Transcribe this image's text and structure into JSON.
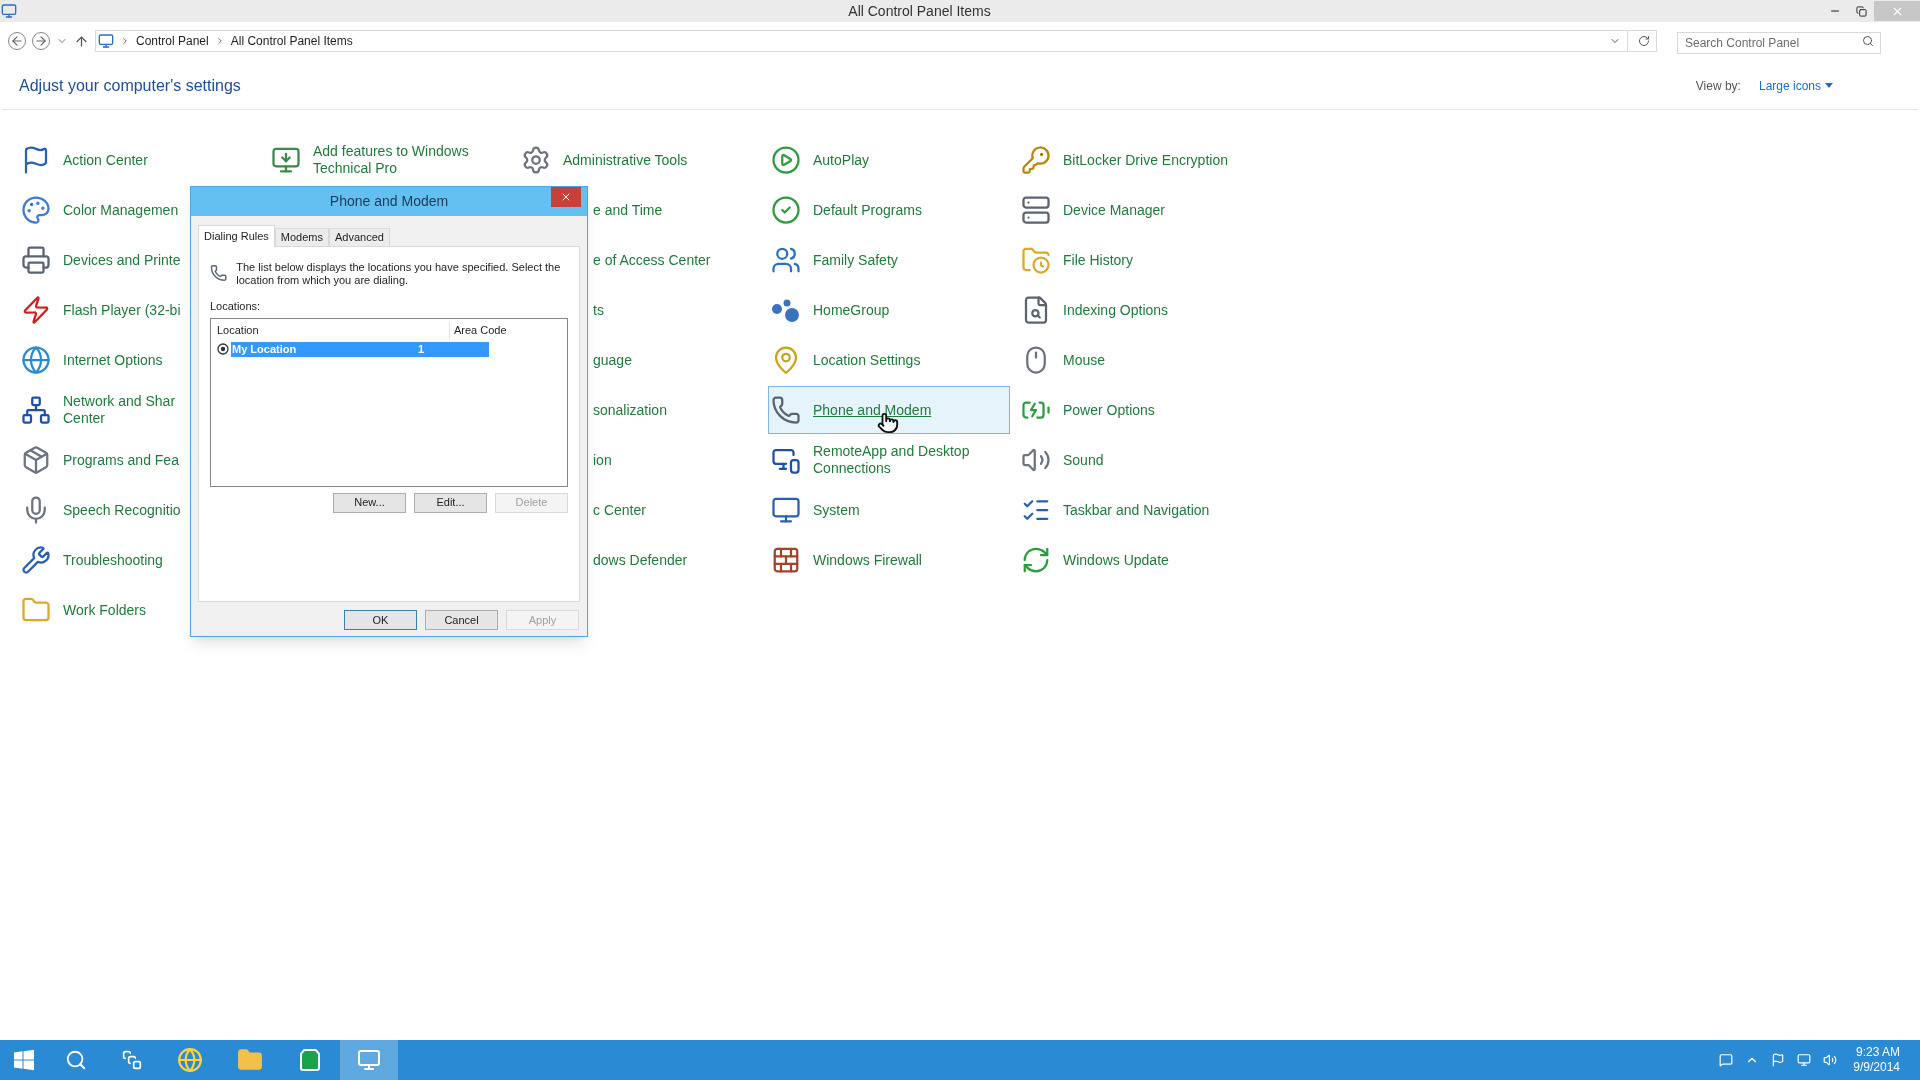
{
  "window": {
    "title": "All Control Panel Items"
  },
  "address_bar": {
    "path": [
      "Control Panel",
      "All Control Panel Items"
    ]
  },
  "search": {
    "placeholder": "Search Control Panel"
  },
  "heading": "Adjust your computer's settings",
  "view_by": {
    "label": "View by:",
    "value": "Large icons"
  },
  "columns": [
    [
      {
        "kind": "full",
        "label": "Action Center",
        "selected": false
      },
      {
        "kind": "full",
        "label": "Color Managemen",
        "selected": false
      },
      {
        "kind": "full",
        "label": "Devices and Printe",
        "selected": false
      },
      {
        "kind": "full",
        "label": "Flash Player (32-bi",
        "selected": false
      },
      {
        "kind": "full",
        "label": "Internet Options",
        "selected": false
      },
      {
        "kind": "full",
        "label": "Network and Shar\nCenter",
        "selected": false
      },
      {
        "kind": "full",
        "label": "Programs and Fea",
        "selected": false
      },
      {
        "kind": "full",
        "label": "Speech Recognitio",
        "selected": false
      },
      {
        "kind": "full",
        "label": "Troubleshooting",
        "selected": false
      },
      {
        "kind": "full",
        "label": "Work Folders",
        "selected": false
      }
    ],
    [
      {
        "kind": "full",
        "label": "Add features to Windows\nTechnical Pro",
        "selected": false
      }
    ],
    [
      {
        "kind": "full",
        "label": "Administrative Tools",
        "selected": false
      },
      {
        "kind": "cut",
        "label": "e and Time",
        "selected": false
      },
      {
        "kind": "cut",
        "label": "e of Access Center",
        "selected": false
      },
      {
        "kind": "cut",
        "label": "ts",
        "selected": false
      },
      {
        "kind": "cut",
        "label": "guage",
        "selected": false
      },
      {
        "kind": "cut",
        "label": "sonalization",
        "selected": false
      },
      {
        "kind": "cut",
        "label": "ion",
        "selected": false
      },
      {
        "kind": "cut",
        "label": "c Center",
        "selected": false
      },
      {
        "kind": "cut",
        "label": "dows Defender",
        "selected": false
      }
    ],
    [
      {
        "kind": "full",
        "label": "AutoPlay",
        "selected": false
      },
      {
        "kind": "full",
        "label": "Default Programs",
        "selected": false
      },
      {
        "kind": "full",
        "label": "Family Safety",
        "selected": false
      },
      {
        "kind": "full",
        "label": "HomeGroup",
        "selected": false
      },
      {
        "kind": "full",
        "label": "Location Settings",
        "selected": false
      },
      {
        "kind": "full",
        "label": "Phone and Modem",
        "selected": true
      },
      {
        "kind": "full",
        "label": "RemoteApp and Desktop Connections",
        "selected": false
      },
      {
        "kind": "full",
        "label": "System",
        "selected": false
      },
      {
        "kind": "full",
        "label": "Windows Firewall",
        "selected": false
      }
    ],
    [
      {
        "kind": "full",
        "label": "BitLocker Drive Encryption",
        "selected": false
      },
      {
        "kind": "full",
        "label": "Device Manager",
        "selected": false
      },
      {
        "kind": "full",
        "label": "File History",
        "selected": false
      },
      {
        "kind": "full",
        "label": "Indexing Options",
        "selected": false
      },
      {
        "kind": "full",
        "label": "Mouse",
        "selected": false
      },
      {
        "kind": "full",
        "label": "Power Options",
        "selected": false
      },
      {
        "kind": "full",
        "label": "Sound",
        "selected": false
      },
      {
        "kind": "full",
        "label": "Taskbar and Navigation",
        "selected": false
      },
      {
        "kind": "full",
        "label": "Windows Update",
        "selected": false
      }
    ]
  ],
  "dialog": {
    "title": "Phone and Modem",
    "tabs": [
      {
        "label": "Dialing Rules",
        "selected": true
      },
      {
        "label": "Modems",
        "selected": false
      },
      {
        "label": "Advanced",
        "selected": false
      }
    ],
    "description": "The list below displays the locations you have specified. Select the location from which you are dialing.",
    "list_label": "Locations:",
    "columns": [
      "Location",
      "Area Code"
    ],
    "rows": [
      {
        "location": "My Location",
        "area_code": "1",
        "selected": true
      }
    ],
    "list_buttons": [
      {
        "label": "New...",
        "disabled": false
      },
      {
        "label": "Edit...",
        "disabled": false
      },
      {
        "label": "Delete",
        "disabled": true
      }
    ],
    "buttons": [
      {
        "label": "OK",
        "disabled": false,
        "default": true
      },
      {
        "label": "Cancel",
        "disabled": false,
        "default": false
      },
      {
        "label": "Apply",
        "disabled": true,
        "default": false
      }
    ]
  },
  "taskbar": {
    "time": "9:23 AM",
    "date": "9/9/2014"
  }
}
